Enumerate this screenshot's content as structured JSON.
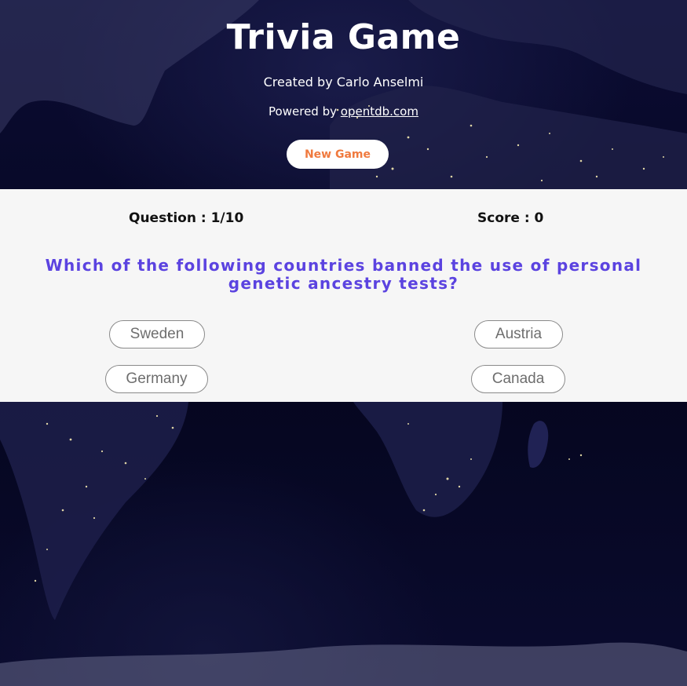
{
  "header": {
    "title": "Trivia Game",
    "credit": "Created by Carlo Anselmi",
    "powered_prefix": "Powered by",
    "powered_link": "opentdb.com",
    "new_game_label": "New Game"
  },
  "game": {
    "question_counter": "Question : 1/10",
    "score": "Score : 0",
    "question": "Which of the following countries banned the use of personal genetic ancestry tests?",
    "answers": [
      "Sweden",
      "Austria",
      "Germany",
      "Canada"
    ]
  },
  "colors": {
    "accent_orange": "#f07a3e",
    "question_purple": "#5b43e0",
    "panel_bg": "#f6f6f6",
    "night_bg": "#07082a"
  },
  "icons": {
    "background": "night-earth-map"
  }
}
